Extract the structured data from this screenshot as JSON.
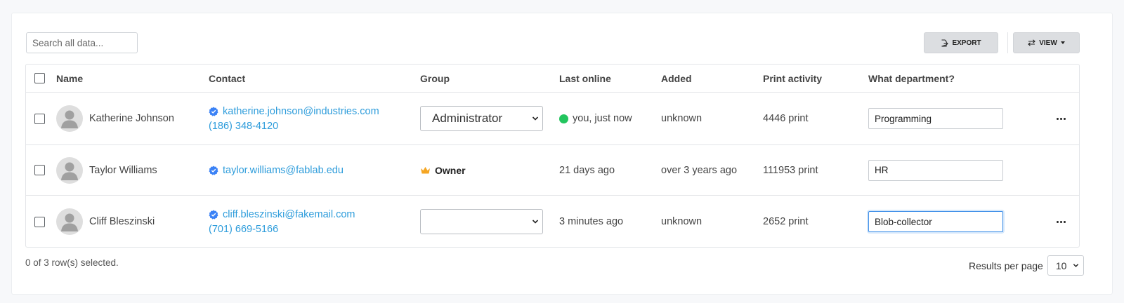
{
  "toolbar": {
    "search_placeholder": "Search all data...",
    "export_label": "EXPORT",
    "view_label": "VIEW"
  },
  "table": {
    "headers": {
      "name": "Name",
      "contact": "Contact",
      "group": "Group",
      "last_online": "Last online",
      "added": "Added",
      "print_activity": "Print activity",
      "department": "What department?"
    },
    "rows": [
      {
        "name": "Katherine Johnson",
        "email": "katherine.johnson@industries.com",
        "phone": "(186) 348-4120",
        "group": "Administrator",
        "last_online": "you, just now",
        "added": "unknown",
        "print_activity": "4446 print",
        "department": "Programming"
      },
      {
        "name": "Taylor Williams",
        "email": "taylor.williams@fablab.edu",
        "phone": "",
        "group": "Owner",
        "last_online": "21 days ago",
        "added": "over 3 years ago",
        "print_activity": "111953 print",
        "department": "HR"
      },
      {
        "name": "Cliff Bleszinski",
        "email": "cliff.bleszinski@fakemail.com",
        "phone": "(701) 669-5166",
        "group": "",
        "last_online": "3 minutes ago",
        "added": "unknown",
        "print_activity": "2652 print",
        "department": "Blob-collector"
      }
    ]
  },
  "footer": {
    "selection_status": "0 of 3 row(s) selected.",
    "results_per_page_label": "Results per page",
    "results_per_page_value": "10"
  },
  "colors": {
    "link": "#2d9cdb",
    "verified_badge": "#3b82f6",
    "online_dot": "#22c55e",
    "owner_crown": "#f5a623",
    "button_bg": "#dcdee1"
  }
}
